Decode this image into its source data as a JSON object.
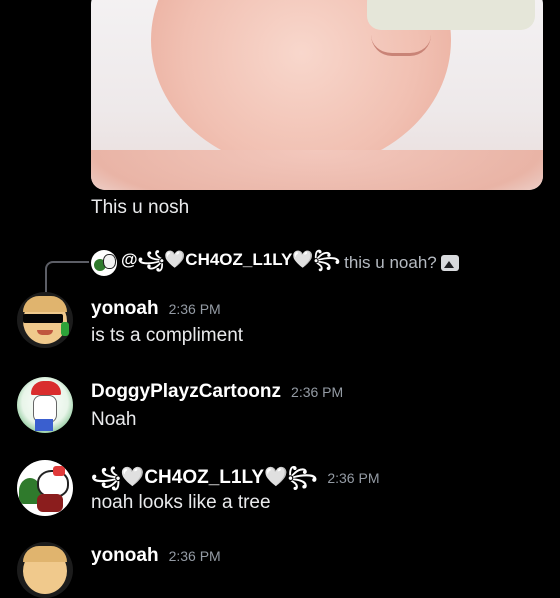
{
  "attachment": {
    "caption": "This u nosh"
  },
  "reply": {
    "mention": "@𖭋♡CH4OZ_L1LY♡𖭌",
    "mention_display": "@꧁🤍CH4OZ_L1LY🤍꧂",
    "text": "this u noah?"
  },
  "messages": [
    {
      "username": "yonoah",
      "time": "2:36 PM",
      "text": "is ts a compliment"
    },
    {
      "username": "DoggyPlayzCartoonz",
      "time": "2:36 PM",
      "text": "Noah"
    },
    {
      "username": "꧁🤍CH4OZ_L1LY🤍꧂",
      "time": "2:36 PM",
      "text": "noah looks like a tree"
    },
    {
      "username": "yonoah",
      "time": "2:36 PM",
      "text": ""
    }
  ],
  "icons": [
    "image-icon"
  ]
}
